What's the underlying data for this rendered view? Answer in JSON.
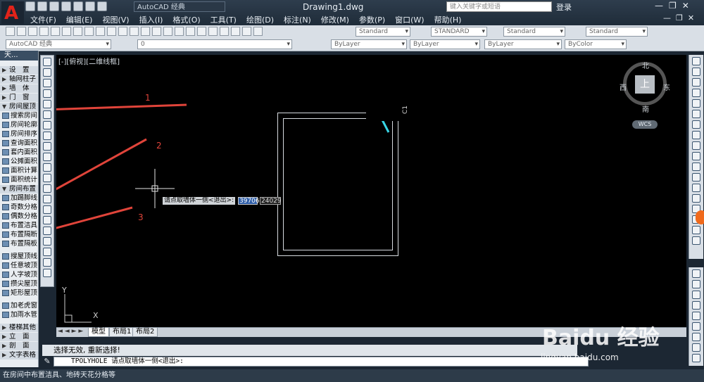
{
  "window": {
    "document_title": "Drawing1.dwg",
    "app_letter": "A",
    "workspace": "AutoCAD 经典"
  },
  "search": {
    "placeholder": "键入关键字或短语"
  },
  "login": "登录",
  "window_controls": [
    "—",
    "❐",
    "✕"
  ],
  "doc_controls": [
    "—",
    "❐",
    "✕"
  ],
  "menus": [
    "文件(F)",
    "编辑(E)",
    "视图(V)",
    "插入(I)",
    "格式(O)",
    "工具(T)",
    "绘图(D)",
    "标注(N)",
    "修改(M)",
    "参数(P)",
    "窗口(W)",
    "帮助(H)"
  ],
  "toolbar": {
    "text_style": "Standard",
    "dim_style": "STANDARD",
    "table_style": "Standard",
    "mleader_style": "Standard",
    "workspace2": "AutoCAD 经典",
    "layer": "0",
    "color": "ByLayer",
    "linetype": "ByLayer",
    "lineweight": "ByLayer",
    "plotstyle": "ByColor"
  },
  "palette": {
    "title": "天...",
    "items": [
      {
        "label": "设　置",
        "group": true
      },
      {
        "label": "轴网柱子",
        "group": true
      },
      {
        "label": "墙　体",
        "group": true
      },
      {
        "label": "门　窗",
        "group": true
      },
      {
        "label": "房间屋顶",
        "group": true,
        "expanded": true
      },
      {
        "label": "搜索房间"
      },
      {
        "label": "房间轮廓"
      },
      {
        "label": "房间排序"
      },
      {
        "label": "查询面积"
      },
      {
        "label": "套内面积"
      },
      {
        "label": "公摊面积"
      },
      {
        "label": "面积计算"
      },
      {
        "label": "面积统计"
      },
      {
        "label": "房间布置",
        "group": true,
        "expanded": true
      },
      {
        "label": "加踢脚线"
      },
      {
        "label": "奇数分格"
      },
      {
        "label": "偶数分格"
      },
      {
        "label": "布置洁具"
      },
      {
        "label": "布置隔断"
      },
      {
        "label": "布置隔板"
      },
      {
        "label": "搜屋顶线"
      },
      {
        "label": "任意坡顶"
      },
      {
        "label": "人字坡顶"
      },
      {
        "label": "攒尖屋顶"
      },
      {
        "label": "矩形屋顶"
      },
      {
        "label": "加老虎窗"
      },
      {
        "label": "加雨水管"
      },
      {
        "label": "楼梯其他",
        "group": true
      },
      {
        "label": "立　面",
        "group": true
      },
      {
        "label": "剖　面",
        "group": true
      },
      {
        "label": "文字表格",
        "group": true
      }
    ]
  },
  "canvas": {
    "view_label": "[-][俯视][二维线框]",
    "compass": {
      "top": "上",
      "north": "北",
      "south": "南",
      "east": "东",
      "west": "西"
    },
    "wcs": "WCS",
    "prompt": "请点取墙体一侧<退出>:",
    "input_value": "39706",
    "input_value2": "24029",
    "label_c1": "C1",
    "annotations": [
      "1",
      "2",
      "3"
    ],
    "ucs_x": "X",
    "ucs_y": "Y"
  },
  "layout_tabs": [
    "模型",
    "布局1",
    "布局2"
  ],
  "command": {
    "history": "选择无效, 重新选择!",
    "current": "TPOLYHOLE 请点取墙体一侧<退出>:"
  },
  "status_text": "在房间中布置洁具、地砖天花分格等",
  "watermark": {
    "brand": "Baidu 经验",
    "url": "jingyan.baidu.com"
  },
  "colors": {
    "arrow_red": "#e0443a",
    "accent_cyan": "#38d6e6",
    "canvas_bg": "#000000"
  }
}
